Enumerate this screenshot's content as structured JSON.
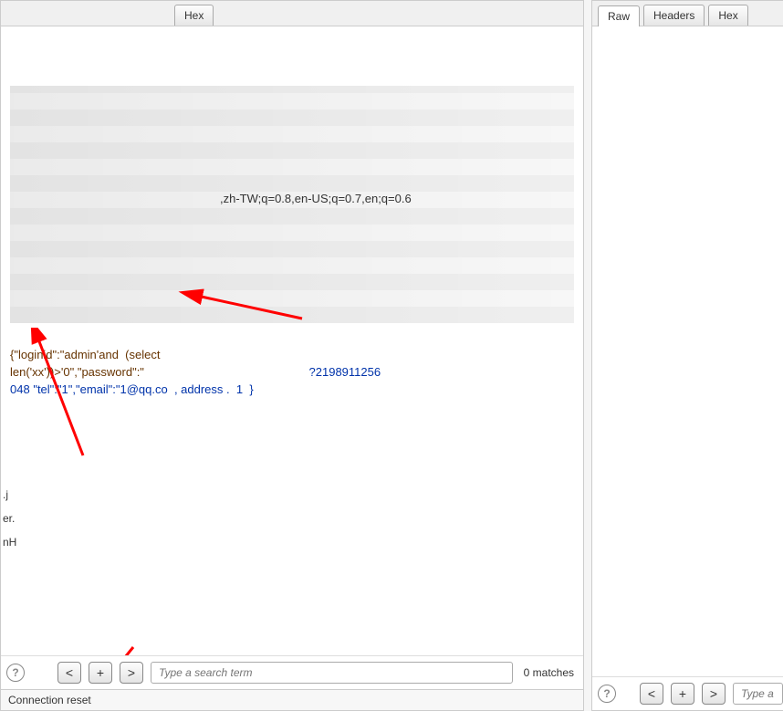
{
  "left": {
    "tabs": {
      "hex": "Hex"
    },
    "accept_lang_fragment": ",zh-TW;q=0.8,en-US;q=0.7,en;q=0.6",
    "payload_line1": "{\"loginid\":\"admin'and  (select",
    "payload_line2_a": "len('xx'))>'0\",\"password\":\"",
    "payload_line2_b": "?2198911256",
    "payload_line3_a": "048",
    "payload_line3_b": "\"tel\":\"1\",\"email\":\"1@qq.co  , address .  1  }",
    "gutter1": ".j",
    "gutter2": "er.",
    "gutter3": "nH",
    "search_placeholder": "Type a search term",
    "matches": "0 matches",
    "status": "Connection reset",
    "btn_prev": "<",
    "btn_plus": "+",
    "btn_next": ">",
    "help": "?"
  },
  "right": {
    "tabs": {
      "raw": "Raw",
      "headers": "Headers",
      "hex": "Hex"
    },
    "search_placeholder": "Type a",
    "btn_prev": "<",
    "btn_plus": "+",
    "btn_next": ">",
    "help": "?"
  }
}
